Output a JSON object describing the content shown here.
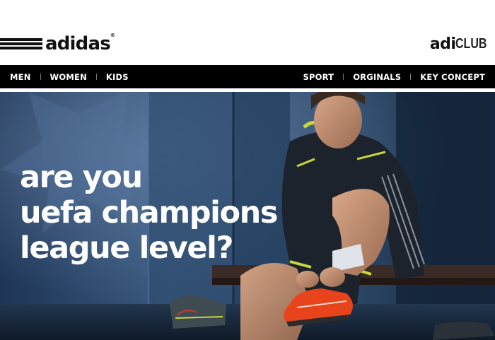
{
  "header": {
    "logo_text": "adidas",
    "logo_mark": "®",
    "adiclub_part1": "adi",
    "adiclub_part2": "CLUB"
  },
  "nav": {
    "left": [
      "MEN",
      "WOMEN",
      "KIDS"
    ],
    "right": [
      "SPORT",
      "ORGINALS",
      "KEY CONCEPT"
    ]
  },
  "hero": {
    "headline_lines": [
      "are you",
      "uefa champions",
      "league level?"
    ]
  },
  "colors": {
    "nav_bg": "#000000",
    "hero_bg": "#2a4463",
    "accent_yellow": "#c8d83a",
    "boot_red": "#e8441c"
  },
  "icons": {
    "logo_stripes": "three-stripes-icon"
  }
}
